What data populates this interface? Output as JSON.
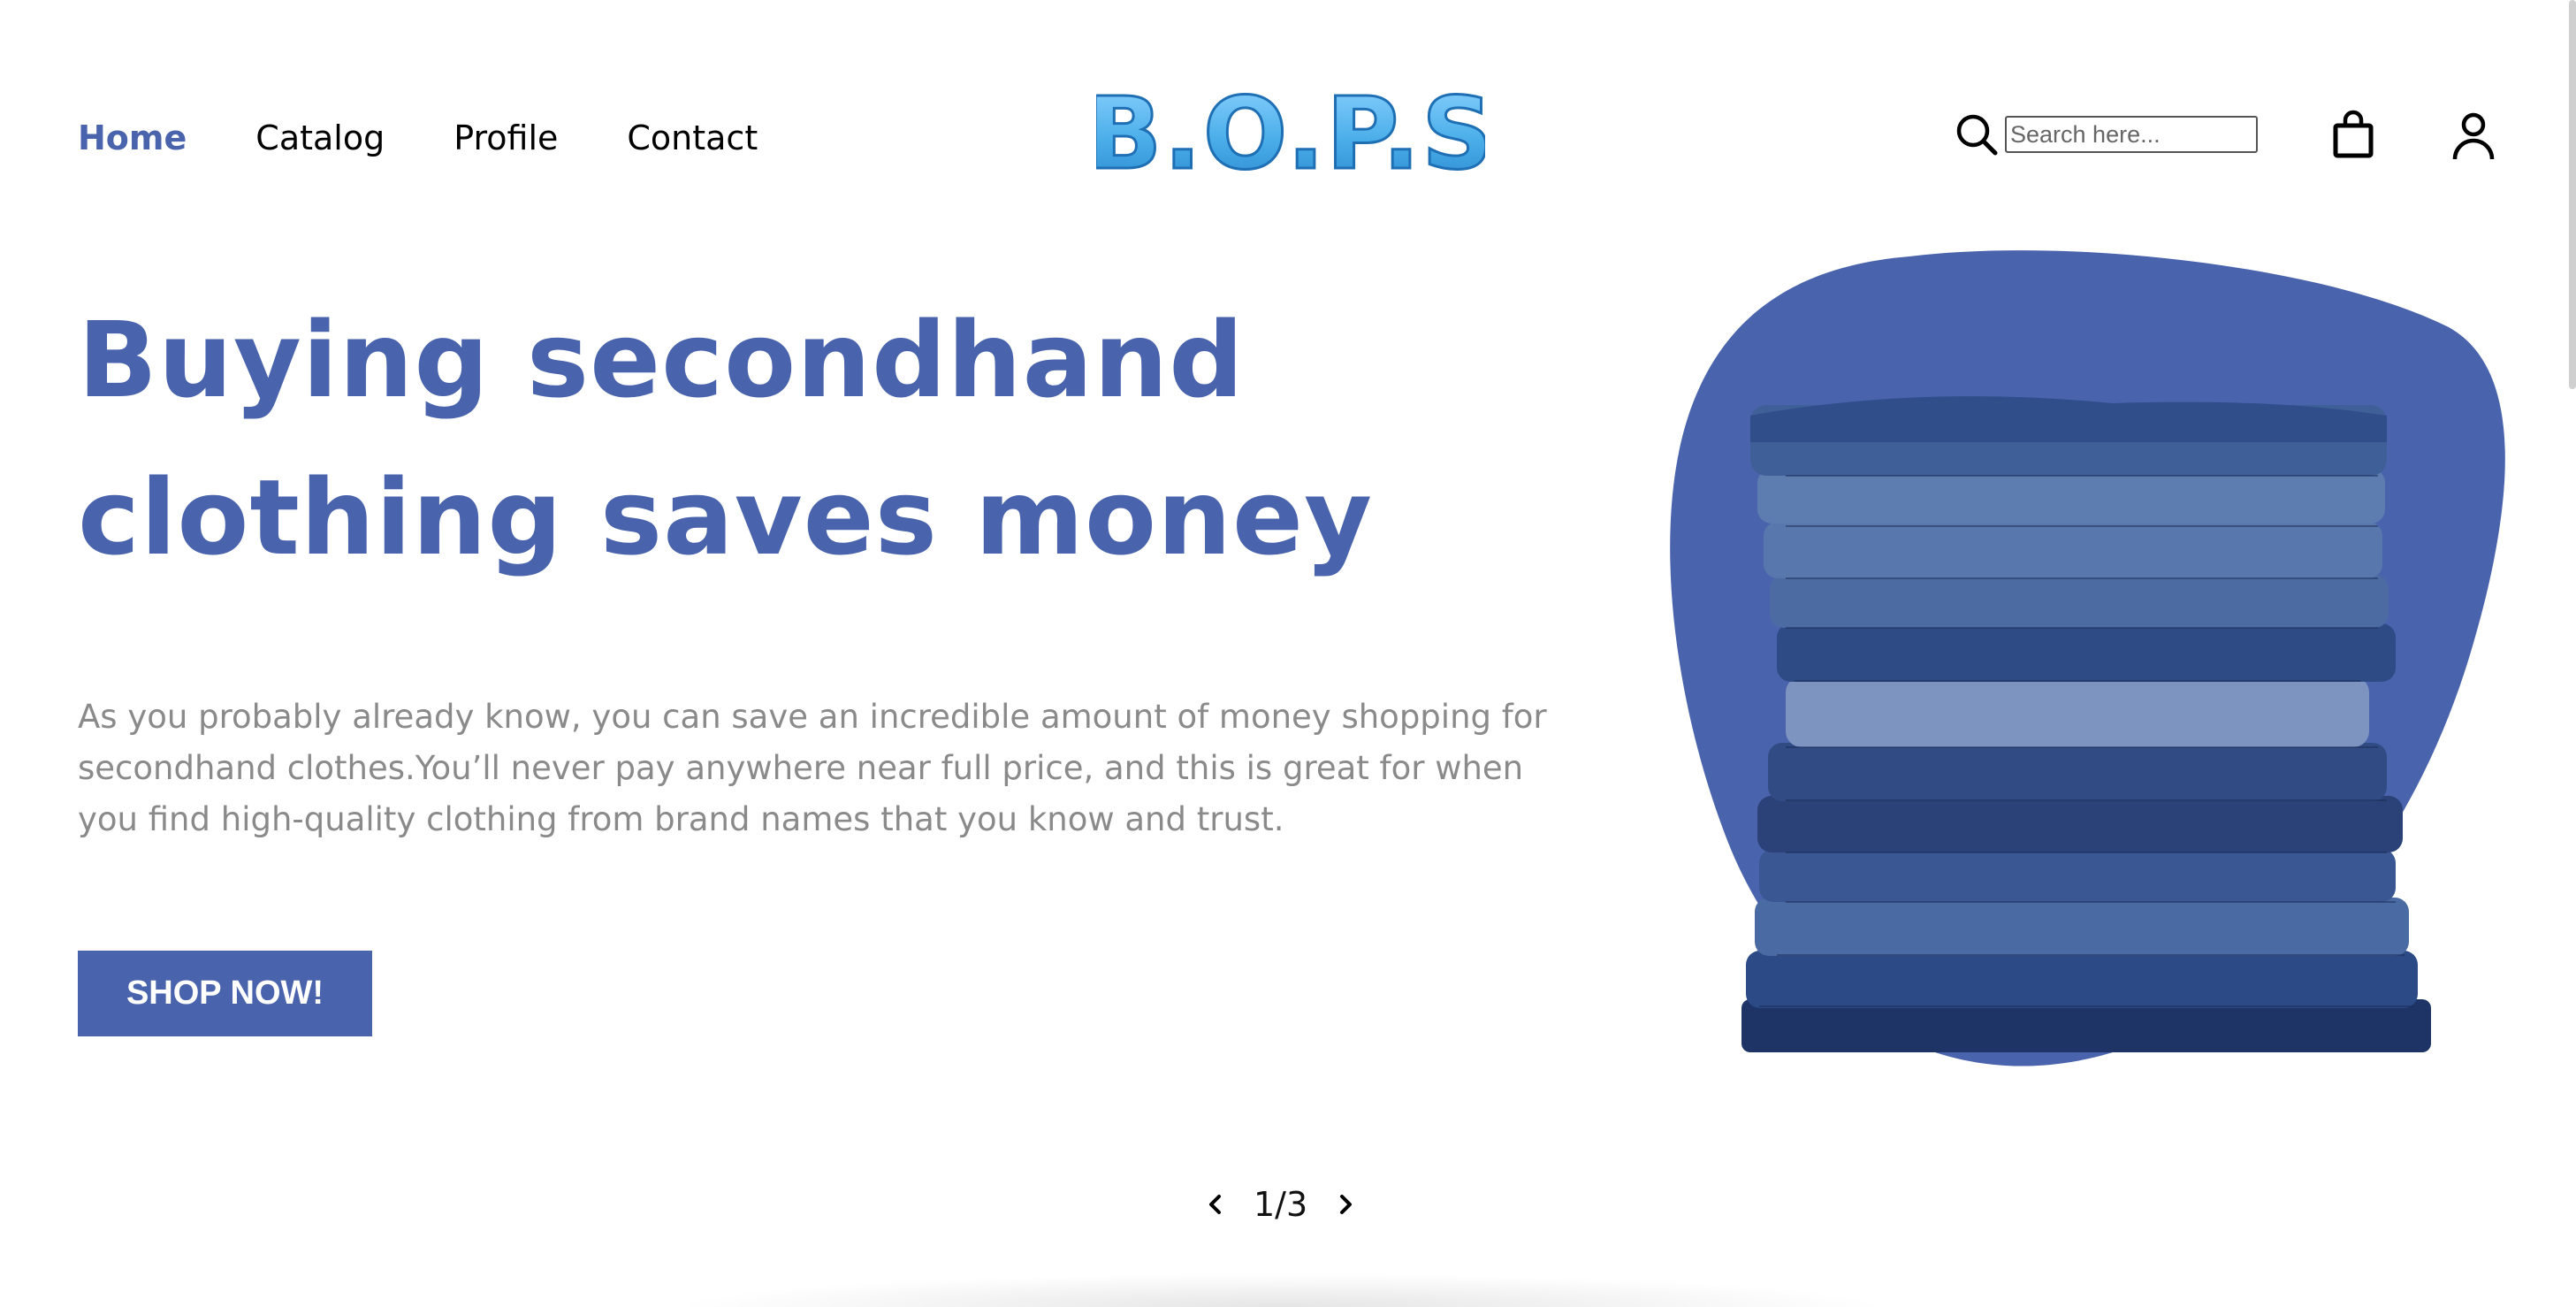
{
  "nav": {
    "items": [
      {
        "label": "Home",
        "active": true
      },
      {
        "label": "Catalog",
        "active": false
      },
      {
        "label": "Profile",
        "active": false
      },
      {
        "label": "Contact",
        "active": false
      }
    ]
  },
  "logo": {
    "text": "B.O.P.S"
  },
  "search": {
    "placeholder": "Search here...",
    "value": ""
  },
  "icons": {
    "search": "search-icon",
    "cart": "shopping-bag-icon",
    "user": "user-icon"
  },
  "hero": {
    "title": "Buying secondhand clothing saves money",
    "text": "As you probably already know, you can save an incredible amount of money shopping for secondhand clothes.You’ll never pay anywhere near full price, and this is great for when you find high-quality clothing from brand names that you know and trust.",
    "cta": "SHOP NOW!"
  },
  "pager": {
    "current_label": "1/3"
  },
  "colors": {
    "accent": "#4a63ad",
    "body_text": "#8a8a8a",
    "logo": "#4fb0e8"
  }
}
